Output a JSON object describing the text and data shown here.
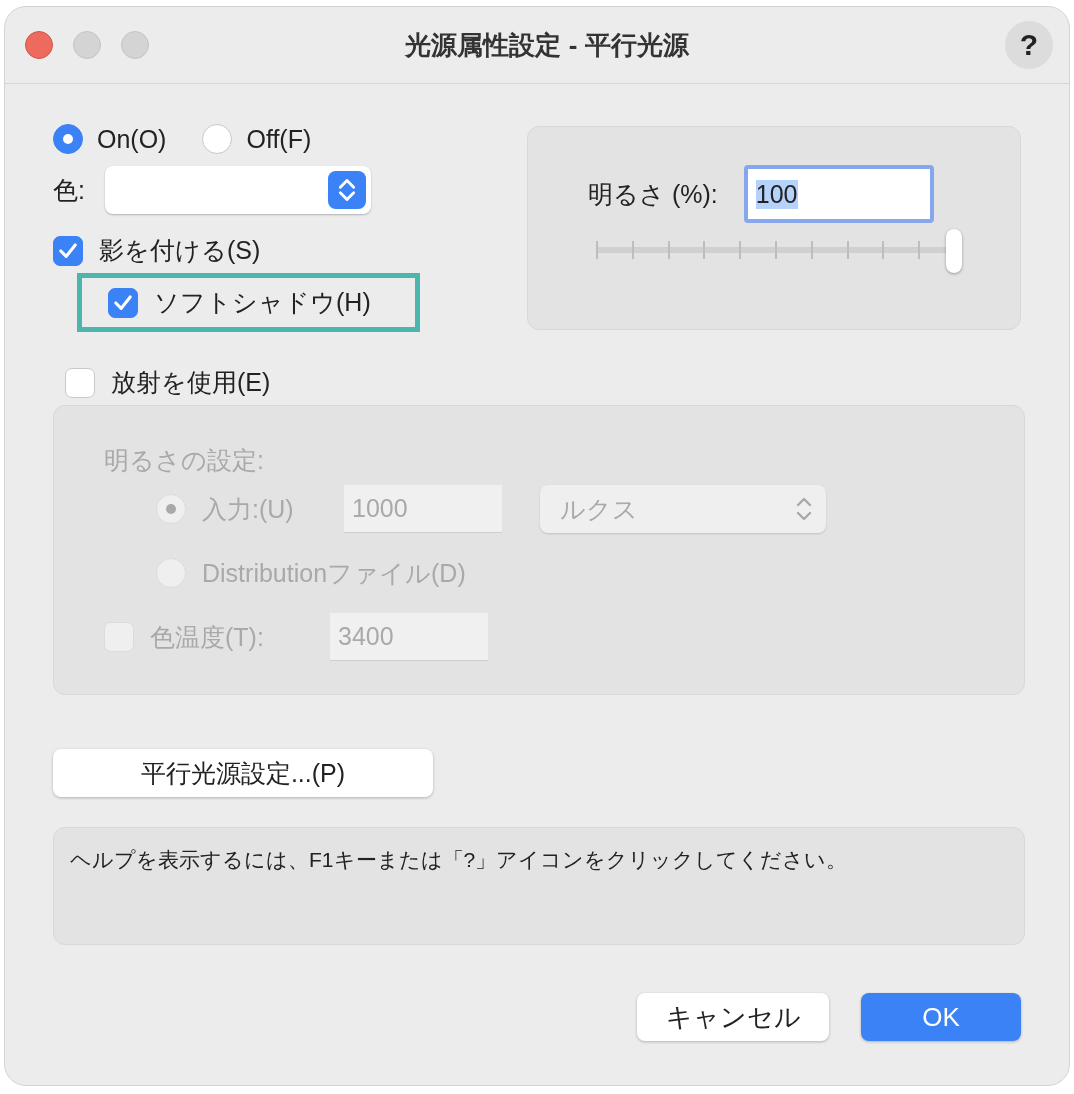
{
  "window": {
    "title": "光源属性設定 - 平行光源",
    "help": "?"
  },
  "light": {
    "options": [
      {
        "label": "On(O)",
        "selected": true
      },
      {
        "label": "Off(F)",
        "selected": false
      }
    ]
  },
  "color": {
    "label": "色:"
  },
  "shadow": {
    "label": "影を付ける(S)",
    "checked": true
  },
  "soft_shadow": {
    "label": "ソフトシャドウ(H)",
    "checked": true,
    "highlighted": true
  },
  "brightness": {
    "label": "明るさ (%):",
    "value": "100",
    "level": 1
  },
  "emission": {
    "label": "放射を使用(E)",
    "checked": false,
    "title": "明るさの設定:",
    "options": [
      {
        "label": "入力:(U)",
        "selected": true,
        "value": "1000",
        "unit": "ルクス"
      },
      {
        "label": "Distributionファイル(D)",
        "selected": false
      }
    ],
    "color_temp": {
      "label": "色温度(T):",
      "checked": false,
      "value": "3400"
    }
  },
  "parallel_button": "平行光源設定...(P)",
  "help_text": "ヘルプを表示するには、F1キーまたは「?」アイコンをクリックしてください。",
  "buttons": [
    {
      "label": "キャンセル",
      "kind": "default"
    },
    {
      "label": "OK",
      "kind": "primary"
    }
  ]
}
